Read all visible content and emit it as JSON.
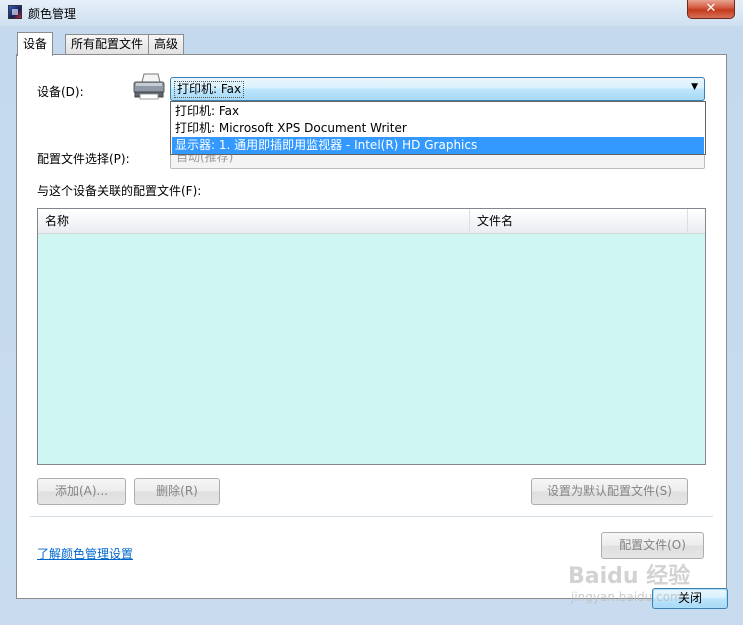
{
  "window": {
    "title": "颜色管理",
    "close_glyph": "✕"
  },
  "tabs": [
    {
      "label": "设备",
      "active": true
    },
    {
      "label": "所有配置文件",
      "active": false
    },
    {
      "label": "高级",
      "active": false
    }
  ],
  "device": {
    "label": "设备(D):",
    "selected": "打印机: Fax",
    "dropdown_options": [
      "打印机: Fax",
      "打印机: Microsoft XPS Document Writer",
      "显示器: 1. 通用即插即用监视器 - Intel(R) HD Graphics"
    ],
    "highlighted_index": 2,
    "icon": "printer-icon"
  },
  "profile_selection": {
    "label": "配置文件选择(P):",
    "value": "自动(推荐)"
  },
  "associated": {
    "label": "与这个设备关联的配置文件(F):",
    "columns": [
      "名称",
      "文件名"
    ],
    "rows": []
  },
  "buttons": {
    "add": "添加(A)...",
    "remove": "删除(R)",
    "set_default": "设置为默认配置文件(S)",
    "profiles": "配置文件(O)",
    "close": "关闭"
  },
  "link": "了解颜色管理设置",
  "watermark": {
    "text": "Baidu 经验",
    "sub": "jingyan.baidu.com"
  },
  "colors": {
    "list_bg": "#d0f6f3",
    "selection": "#3399ff",
    "link": "#0066cc"
  }
}
